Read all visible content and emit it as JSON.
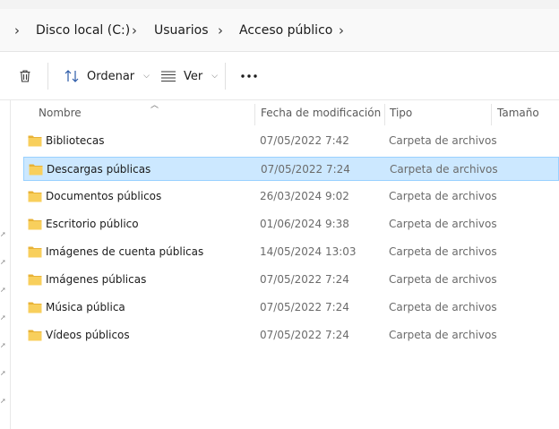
{
  "breadcrumb": {
    "items": [
      "Disco local (C:)",
      "Usuarios",
      "Acceso público"
    ]
  },
  "toolbar": {
    "delete_icon": "trash-icon",
    "sort_label": "Ordenar",
    "view_label": "Ver",
    "more_icon": "ellipsis-icon"
  },
  "columns": {
    "name": "Nombre",
    "date": "Fecha de modificación",
    "type": "Tipo",
    "size": "Tamaño"
  },
  "files": [
    {
      "name": "Bibliotecas",
      "date": "07/05/2022 7:42",
      "type": "Carpeta de archivos",
      "selected": false
    },
    {
      "name": "Descargas públicas",
      "date": "07/05/2022 7:24",
      "type": "Carpeta de archivos",
      "selected": true
    },
    {
      "name": "Documentos públicos",
      "date": "26/03/2024 9:02",
      "type": "Carpeta de archivos",
      "selected": false
    },
    {
      "name": "Escritorio público",
      "date": "01/06/2024 9:38",
      "type": "Carpeta de archivos",
      "selected": false
    },
    {
      "name": "Imágenes de cuenta públicas",
      "date": "14/05/2024 13:03",
      "type": "Carpeta de archivos",
      "selected": false
    },
    {
      "name": "Imágenes públicas",
      "date": "07/05/2022 7:24",
      "type": "Carpeta de archivos",
      "selected": false
    },
    {
      "name": "Música pública",
      "date": "07/05/2022 7:24",
      "type": "Carpeta de archivos",
      "selected": false
    },
    {
      "name": "Vídeos públicos",
      "date": "07/05/2022 7:24",
      "type": "Carpeta de archivos",
      "selected": false
    }
  ],
  "colors": {
    "selection_bg": "#cce8ff",
    "selection_border": "#99d1ff",
    "folder": "#f5c24c"
  }
}
